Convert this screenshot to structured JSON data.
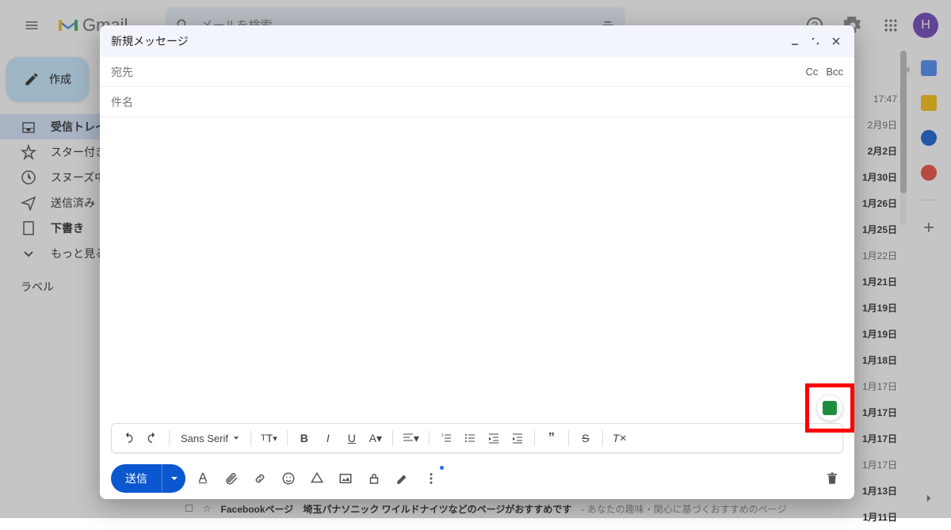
{
  "header": {
    "logo_text": "Gmail",
    "search_placeholder": "メールを検索",
    "avatar_initial": "H"
  },
  "sidebar": {
    "compose_label": "作成",
    "items": [
      {
        "icon": "inbox",
        "label": "受信トレイ",
        "active": true
      },
      {
        "icon": "star",
        "label": "スター付き"
      },
      {
        "icon": "clock",
        "label": "スヌーズ中"
      },
      {
        "icon": "send",
        "label": "送信済み"
      },
      {
        "icon": "draft",
        "label": "下書き",
        "bold": true
      },
      {
        "icon": "more",
        "label": "もっと見る"
      }
    ],
    "labels_header": "ラベル"
  },
  "dates": [
    {
      "text": "17:47",
      "bold": false
    },
    {
      "text": "2月9日",
      "bold": false
    },
    {
      "text": "2月2日",
      "bold": true
    },
    {
      "text": "1月30日",
      "bold": true
    },
    {
      "text": "1月26日",
      "bold": true
    },
    {
      "text": "1月25日",
      "bold": true
    },
    {
      "text": "1月22日",
      "bold": false
    },
    {
      "text": "1月21日",
      "bold": true
    },
    {
      "text": "1月19日",
      "bold": true
    },
    {
      "text": "1月19日",
      "bold": true
    },
    {
      "text": "1月18日",
      "bold": true
    },
    {
      "text": "1月17日",
      "bold": false
    },
    {
      "text": "1月17日",
      "bold": true
    },
    {
      "text": "1月17日",
      "bold": true
    },
    {
      "text": "1月17日",
      "bold": false
    },
    {
      "text": "1月13日",
      "bold": true
    },
    {
      "text": "1月11日",
      "bold": true
    }
  ],
  "compose": {
    "title": "新規メッセージ",
    "to_label": "宛先",
    "cc_label": "Cc",
    "bcc_label": "Bcc",
    "subject_label": "件名",
    "font_name": "Sans Serif",
    "send_label": "送信"
  },
  "bottom_row": {
    "sender": "Facebookページ",
    "subject": "埼玉パナソニック ワイルドナイツなどのページがおすすめです",
    "preview": " - あなたの趣味・関心に基づくおすすめのページ"
  },
  "colors": {
    "accent": "#0b57d0",
    "compose_btn": "#c2e7ff",
    "highlight": "#ff0000"
  }
}
